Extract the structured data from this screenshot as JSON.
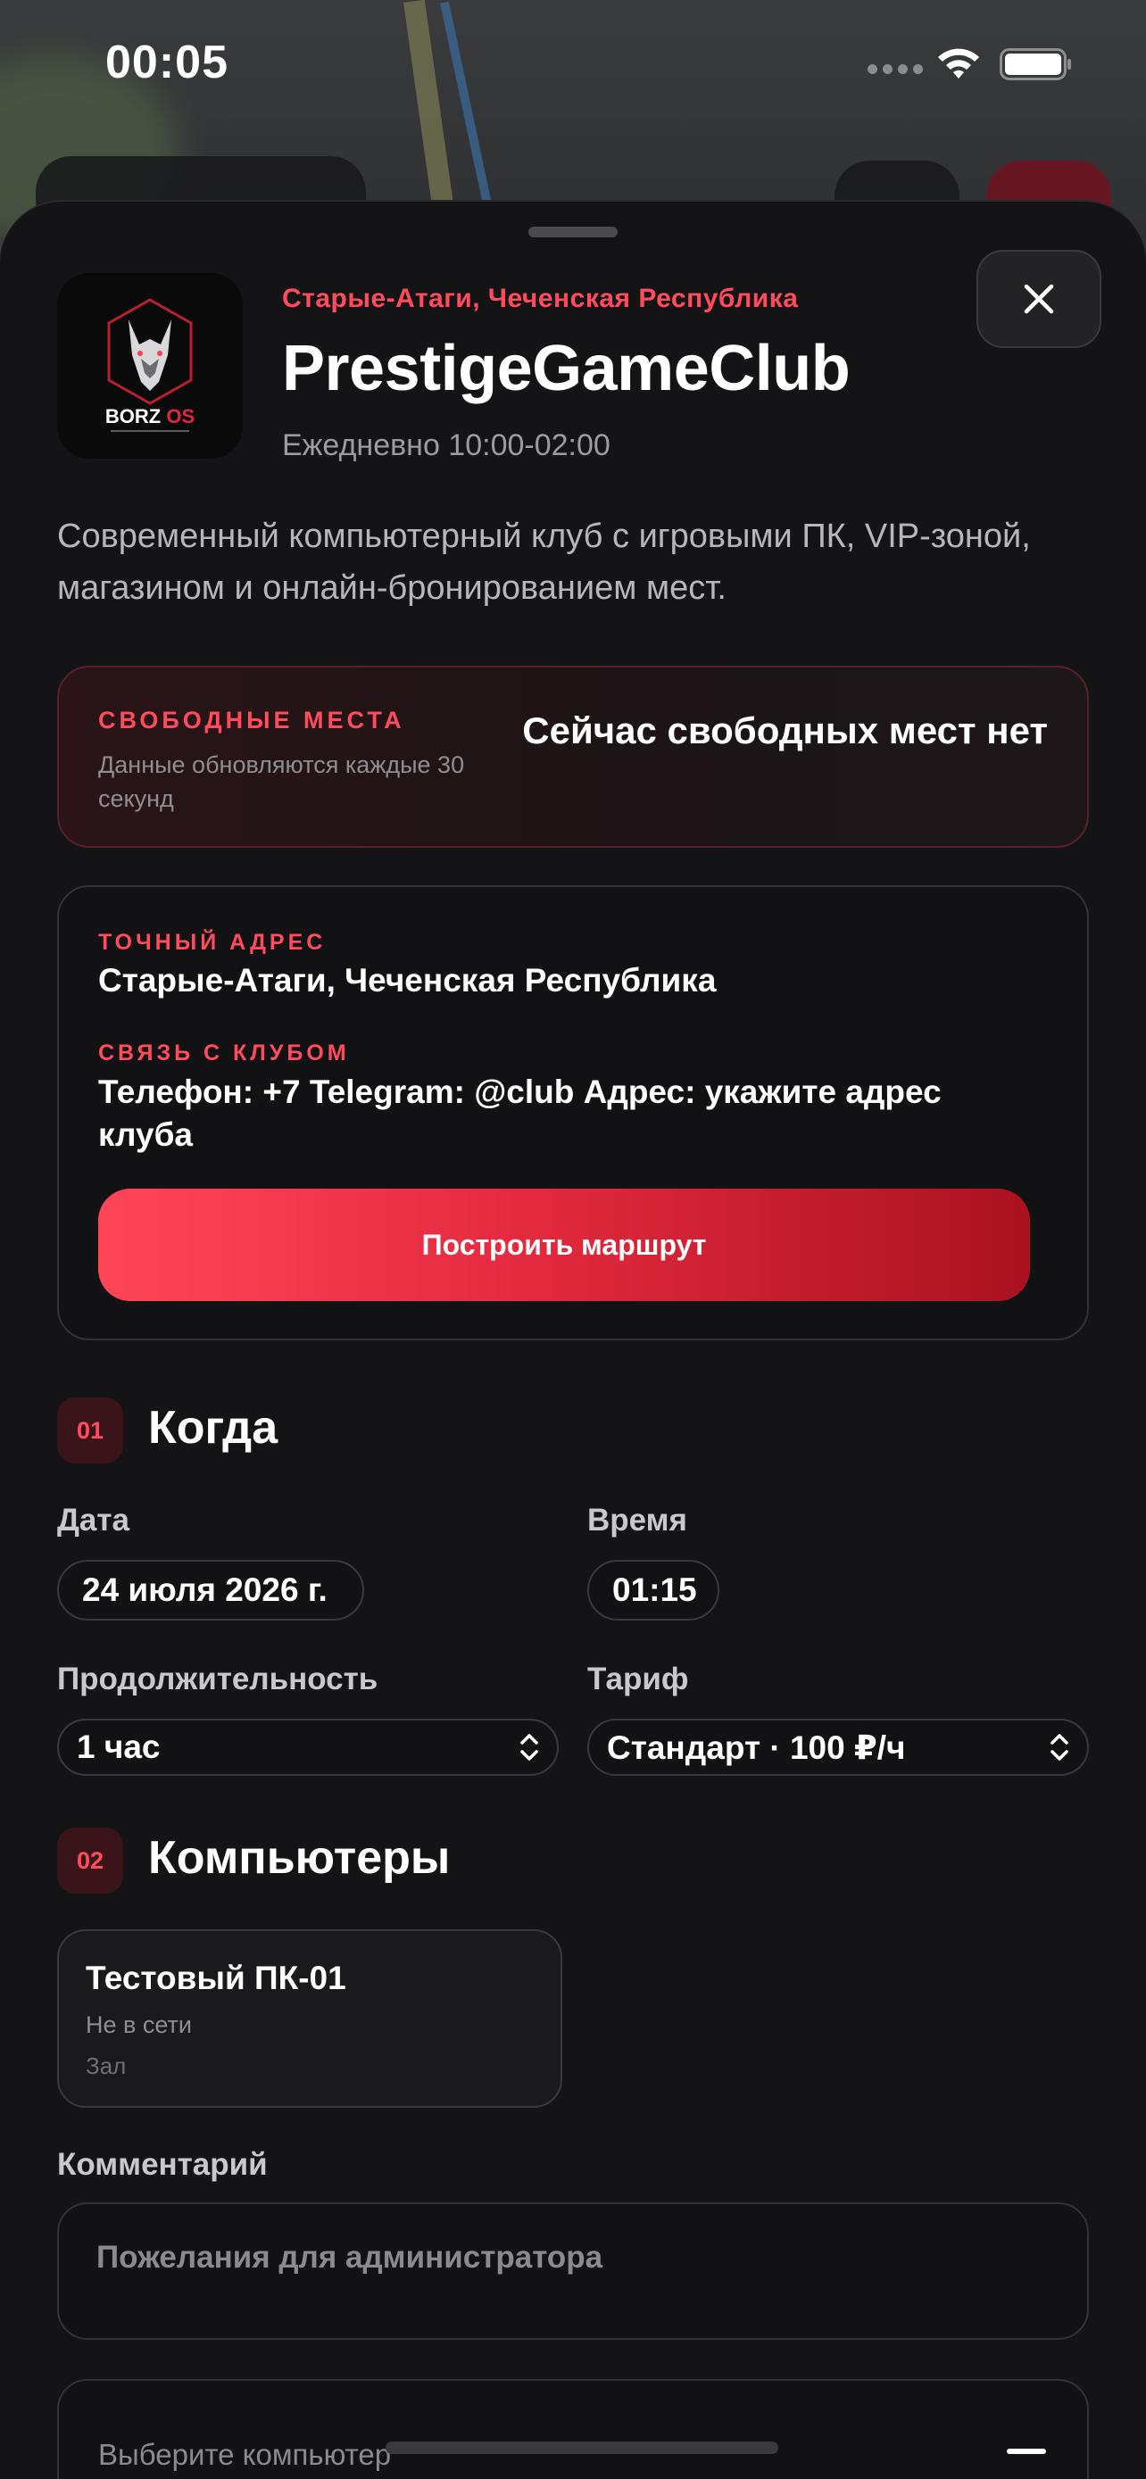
{
  "status_bar": {
    "time": "00:05"
  },
  "club": {
    "location": "Старые-Атаги, Чеченская Республика",
    "name": "PrestigeGameClub",
    "hours": "Ежедневно 10:00-02:00",
    "logo_text": "BORZ OS",
    "description": "Современный компьютерный клуб с игровыми ПК, VIP-зоной, магазином и онлайн-бронированием мест."
  },
  "seats": {
    "kicker": "СВОБОДНЫЕ МЕСТА",
    "note": "Данные обновляются каждые 30 секунд",
    "status": "Сейчас свободных мест нет"
  },
  "info": {
    "address_kicker": "ТОЧНЫЙ АДРЕС",
    "address": "Старые-Атаги, Чеченская Республика",
    "contact_kicker": "СВЯЗЬ С КЛУБОМ",
    "contact": "Телефон: +7 Telegram: @club Адрес: укажите адрес клуба",
    "route_button": "Построить маршрут"
  },
  "when": {
    "badge": "01",
    "title": "Когда",
    "date_label": "Дата",
    "date_value": "24 июля 2026 г.",
    "time_label": "Время",
    "time_value": "01:15",
    "duration_label": "Продолжительность",
    "duration_value": "1 час",
    "tariff_label": "Тариф",
    "tariff_value": "Стандарт · 100 ₽/ч"
  },
  "computers": {
    "badge": "02",
    "title": "Компьютеры",
    "items": [
      {
        "name": "Тестовый ПК-01",
        "status": "Не в сети",
        "zone": "Зал"
      }
    ]
  },
  "comment": {
    "label": "Комментарий",
    "placeholder": "Пожелания для администратора"
  },
  "footer": {
    "label": "Выберите компьютер"
  },
  "colors": {
    "accent": "#ff4b5c",
    "background": "#141416",
    "button_start": "#ff4658",
    "button_end": "#a9121f"
  }
}
